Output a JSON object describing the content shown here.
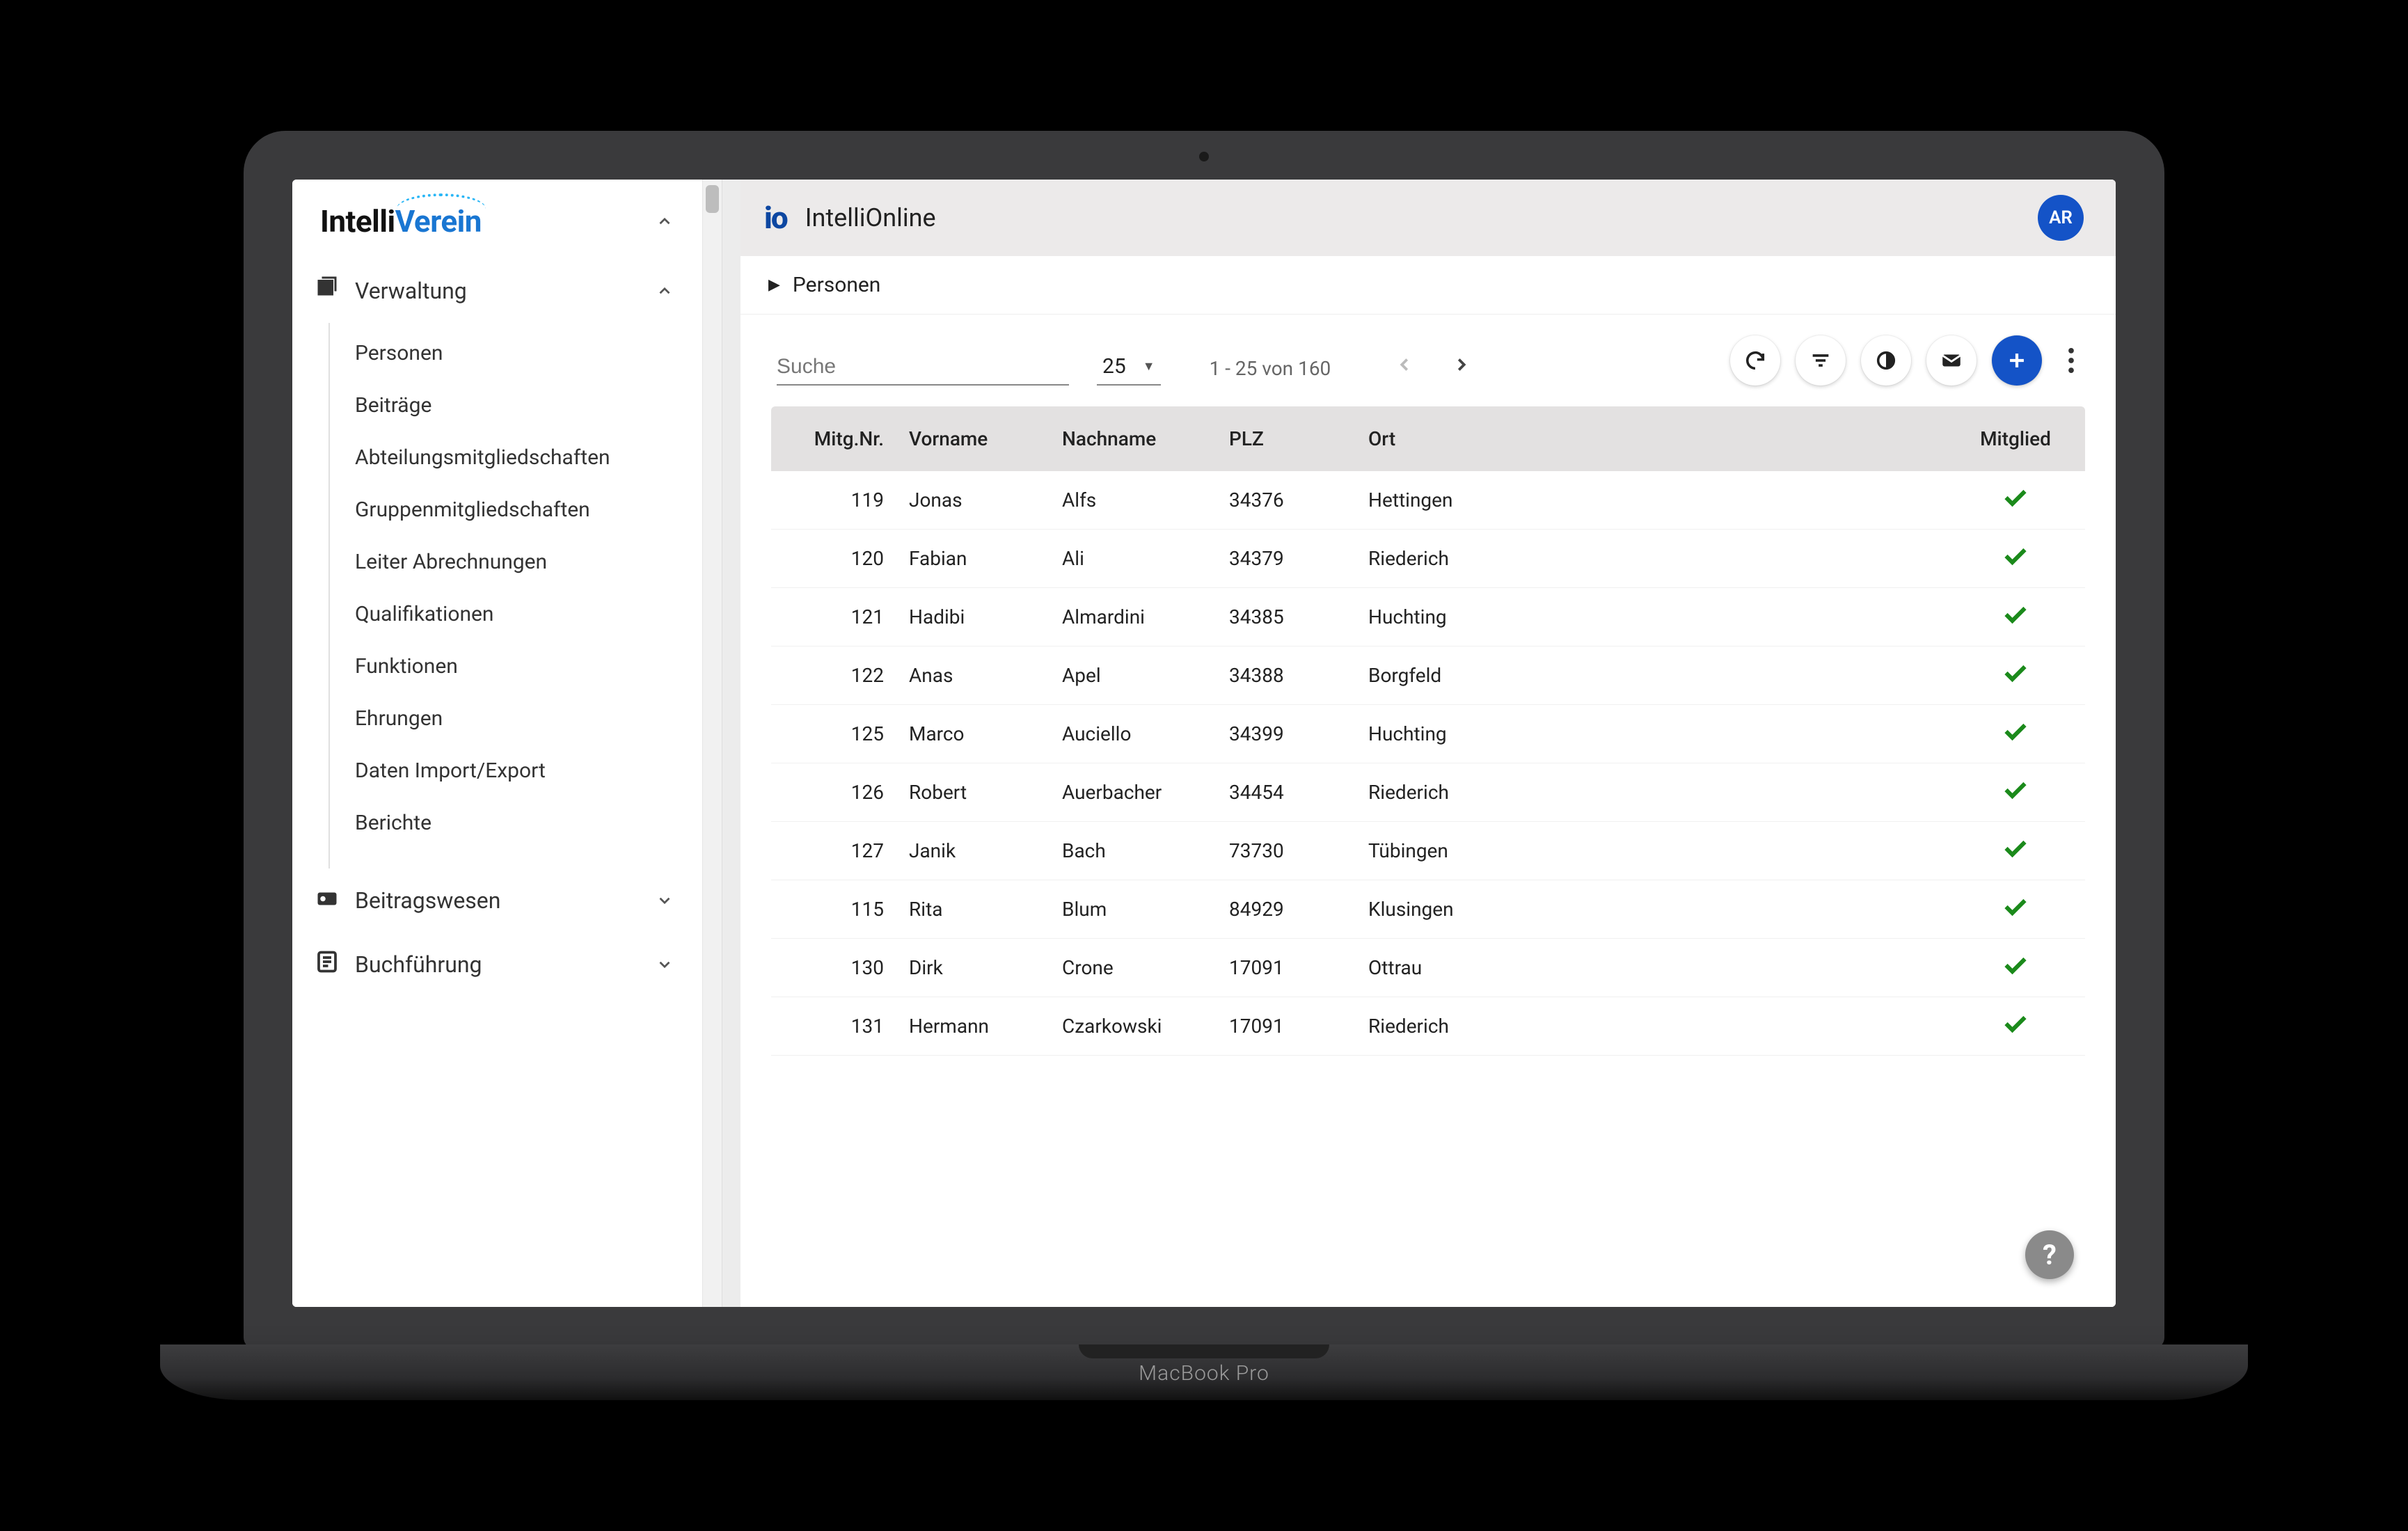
{
  "device_label": "MacBook Pro",
  "brand": {
    "part1": "Intelli",
    "part2": "Verein"
  },
  "sidebar": {
    "sections": [
      {
        "icon": "library",
        "label": "Verwaltung",
        "expanded": true
      },
      {
        "icon": "payments",
        "label": "Beitragswesen",
        "expanded": false
      },
      {
        "icon": "ledger",
        "label": "Buchführung",
        "expanded": false
      }
    ],
    "subitems": [
      "Personen",
      "Beiträge",
      "Abteilungsmitgliedschaften",
      "Gruppenmitgliedschaften",
      "Leiter Abrechnungen",
      "Qualifikationen",
      "Funktionen",
      "Ehrungen",
      "Daten Import/Export",
      "Berichte"
    ]
  },
  "header": {
    "mark": "io",
    "title": "IntelliOnline",
    "avatar": "AR"
  },
  "breadcrumb": {
    "label": "Personen"
  },
  "toolbar": {
    "search_placeholder": "Suche",
    "page_size": "25",
    "pagination": "1 - 25 von 160"
  },
  "columns": [
    "Mitg.Nr.",
    "Vorname",
    "Nachname",
    "PLZ",
    "Ort",
    "Mitglied"
  ],
  "rows": [
    {
      "nr": "119",
      "vor": "Jonas",
      "nach": "Alfs",
      "plz": "34376",
      "ort": "Hettingen",
      "member": true
    },
    {
      "nr": "120",
      "vor": "Fabian",
      "nach": "Ali",
      "plz": "34379",
      "ort": "Riederich",
      "member": true
    },
    {
      "nr": "121",
      "vor": "Hadibi",
      "nach": "Almardini",
      "plz": "34385",
      "ort": "Huchting",
      "member": true
    },
    {
      "nr": "122",
      "vor": "Anas",
      "nach": "Apel",
      "plz": "34388",
      "ort": "Borgfeld",
      "member": true
    },
    {
      "nr": "125",
      "vor": "Marco",
      "nach": "Auciello",
      "plz": "34399",
      "ort": "Huchting",
      "member": true
    },
    {
      "nr": "126",
      "vor": "Robert",
      "nach": "Auerbacher",
      "plz": "34454",
      "ort": "Riederich",
      "member": true
    },
    {
      "nr": "127",
      "vor": "Janik",
      "nach": "Bach",
      "plz": "73730",
      "ort": "Tübingen",
      "member": true
    },
    {
      "nr": "115",
      "vor": "Rita",
      "nach": "Blum",
      "plz": "84929",
      "ort": "Klusingen",
      "member": true
    },
    {
      "nr": "130",
      "vor": "Dirk",
      "nach": "Crone",
      "plz": "17091",
      "ort": "Ottrau",
      "member": true
    },
    {
      "nr": "131",
      "vor": "Hermann",
      "nach": "Czarkowski",
      "plz": "17091",
      "ort": "Riederich",
      "member": true
    }
  ],
  "help": "?"
}
